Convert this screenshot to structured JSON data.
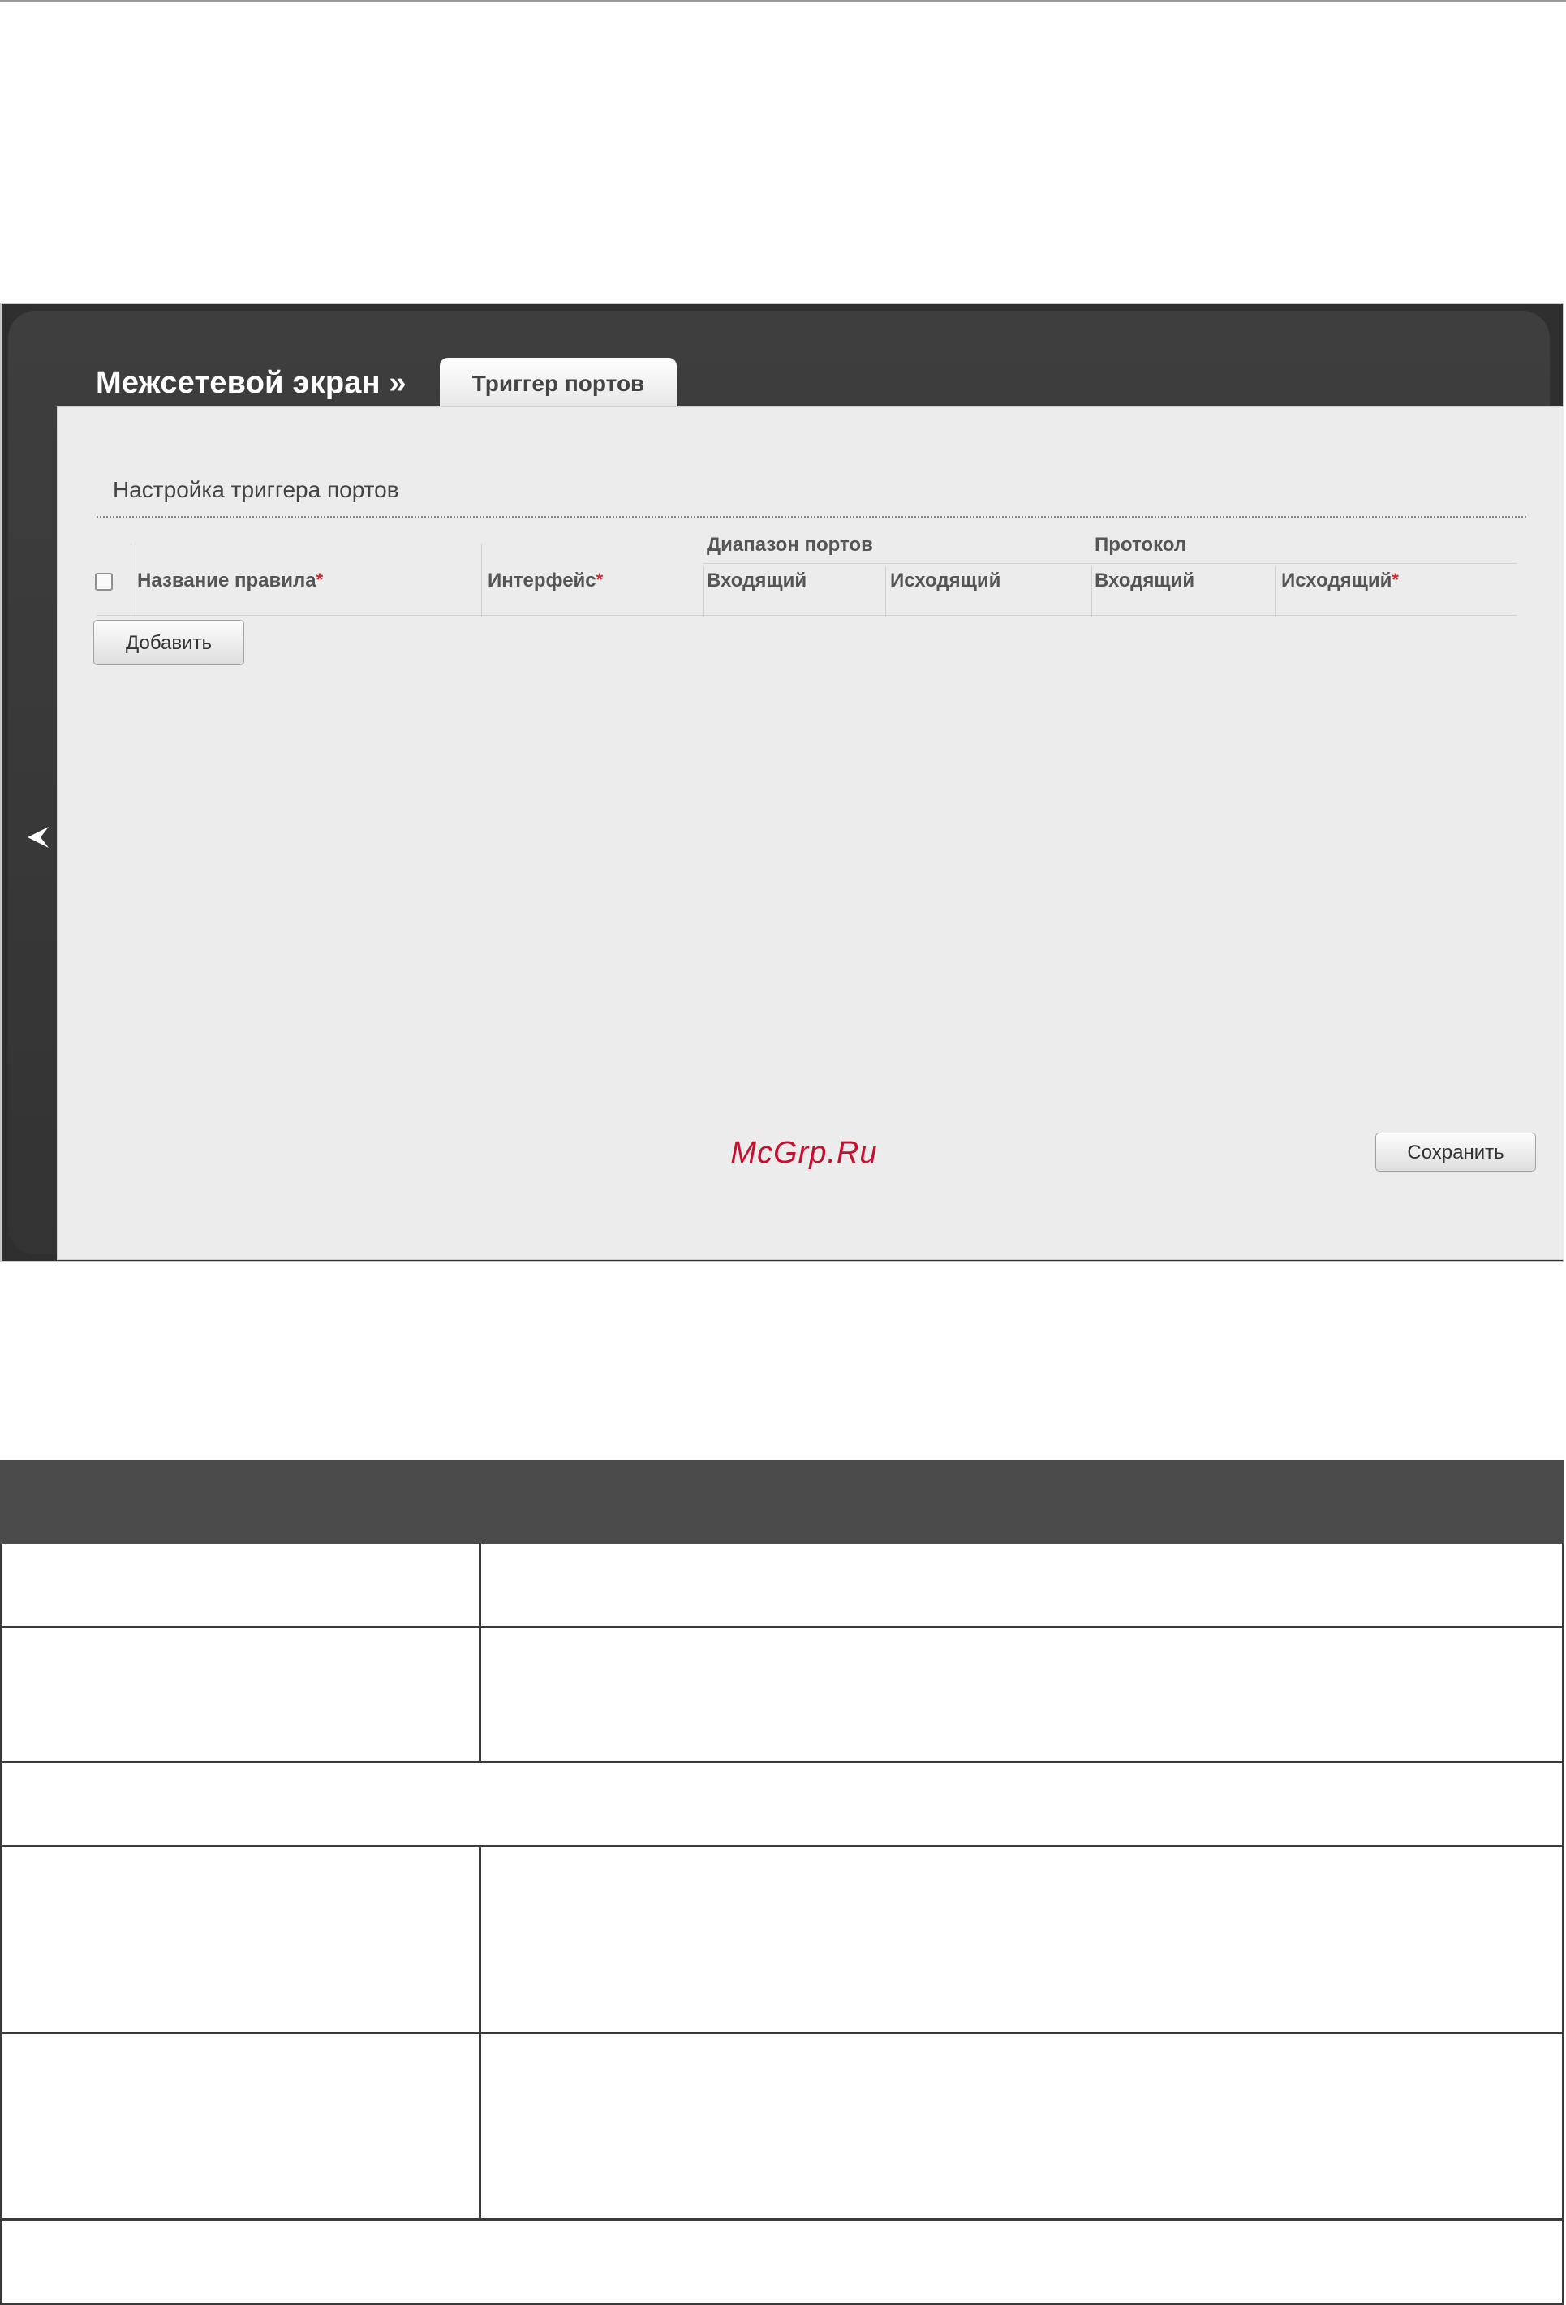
{
  "window": {
    "section_title": "Межсетевой экран »",
    "active_tab": "Триггер портов"
  },
  "panel": {
    "heading": "Настройка триггера портов",
    "columns": {
      "rule_name": "Название правила",
      "interface": "Интерфейс",
      "port_range": "Диапазон портов",
      "protocol": "Протокол",
      "port_in": "Входящий",
      "port_out": "Исходящий",
      "proto_in": "Входящий",
      "proto_out": "Исходящий"
    },
    "required_mark": "*",
    "add_button": "Добавить",
    "save_button": "Сохранить",
    "watermark": "McGrp.Ru"
  },
  "colors": {
    "frame_dark": "#333333",
    "panel_bg": "#ececec",
    "required_star": "#d3272b",
    "watermark": "#c8102e",
    "table_header": "#4b4b4b"
  },
  "icons": {
    "back": "chevron-left-icon"
  }
}
